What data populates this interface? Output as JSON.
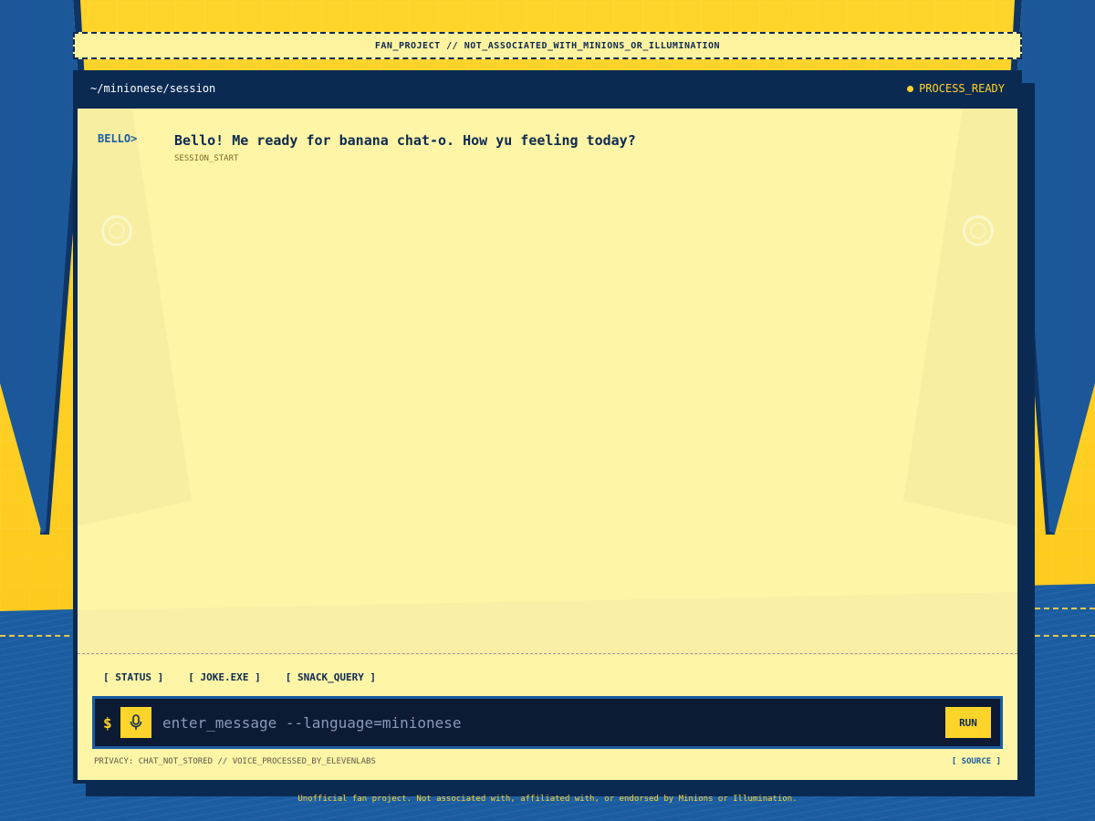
{
  "banner": {
    "text": "FAN_PROJECT // NOT_ASSOCIATED_WITH_MINIONS_OR_ILLUMINATION"
  },
  "titlebar": {
    "path": "~/minionese/session",
    "status": "PROCESS_READY"
  },
  "messages": [
    {
      "prompt": "BELLO>",
      "text": "Bello! Me ready for banana chat-o. How yu feeling today?",
      "meta": "SESSION_START"
    }
  ],
  "quick_actions": [
    "[ STATUS ]",
    "[ JOKE.EXE ]",
    "[ SNACK_QUERY ]"
  ],
  "input": {
    "prefix": "$",
    "placeholder": "enter_message --language=minionese",
    "value": "",
    "run_label": "RUN",
    "mic_icon": "microphone-icon"
  },
  "footer": {
    "privacy": "PRIVACY: CHAT_NOT_STORED // VOICE_PROCESSED_BY_ELEVENLABS",
    "source": "[ SOURCE ]"
  },
  "bottom_note": "Unofficial fan project. Not associated with, affiliated with, or endorsed by Minions or Illumination.",
  "colors": {
    "accent": "#ffd42a",
    "navy": "#0b2a52",
    "denim": "#1a5ca0",
    "screen": "#fff5a6"
  }
}
